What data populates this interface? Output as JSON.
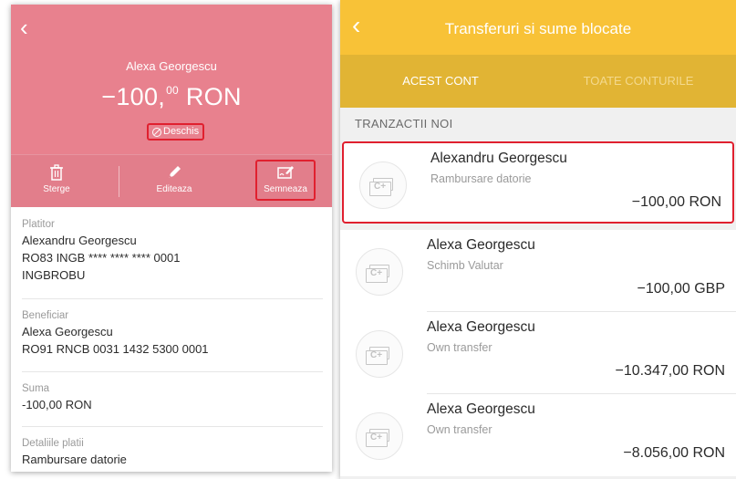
{
  "left": {
    "back_glyph": "‹",
    "name": "Alexa Georgescu",
    "amount_main": "−100,",
    "amount_cents": "00",
    "amount_currency": "RON",
    "status": "Deschis",
    "actions": {
      "delete": "Sterge",
      "edit": "Editeaza",
      "sign": "Semneaza"
    },
    "fields": {
      "payer_label": "Platitor",
      "payer_name": "Alexandru Georgescu",
      "payer_iban": "RO83 INGB **** **** **** 0001",
      "payer_bank": "INGBROBU",
      "beneficiary_label": "Beneficiar",
      "beneficiary_name": "Alexa Georgescu",
      "beneficiary_iban": "RO91 RNCB 0031 1432 5300 0001",
      "amount_label": "Suma",
      "amount_value": "-100,00 RON",
      "details_label": "Detaliile platii",
      "details_value": "Rambursare datorie"
    },
    "colors": {
      "header": "#e8818e",
      "highlight": "#e0202f"
    }
  },
  "right": {
    "back_glyph": "‹",
    "title": "Transferuri si sume blocate",
    "tabs": {
      "this_account": "ACEST CONT",
      "all_accounts": "TOATE CONTURILE"
    },
    "section": "TRANZACTII NOI",
    "transactions": [
      {
        "name": "Alexandru Georgescu",
        "desc": "Rambursare datorie",
        "amount": "−100,00 RON"
      },
      {
        "name": "Alexa Georgescu",
        "desc": "Schimb Valutar",
        "amount": "−100,00 GBP"
      },
      {
        "name": "Alexa Georgescu",
        "desc": "Own transfer",
        "amount": "−10.347,00 RON"
      },
      {
        "name": "Alexa Georgescu",
        "desc": "Own transfer",
        "amount": "−8.056,00 RON"
      }
    ],
    "colors": {
      "top": "#f8c237",
      "tabs": "#e1b434"
    }
  }
}
